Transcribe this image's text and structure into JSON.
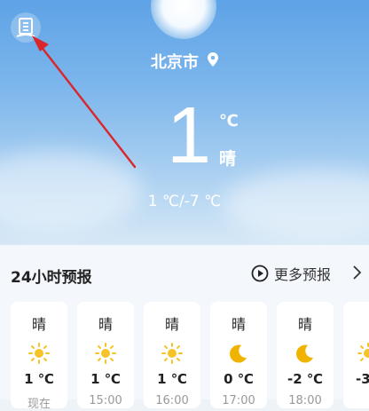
{
  "header": {
    "city": "北京市"
  },
  "current": {
    "temp": "1",
    "unit": "℃",
    "condition": "晴",
    "range": "1 ℃/-7 ℃"
  },
  "forecast": {
    "title": "24小时预报",
    "more_label": "更多预报",
    "cards": [
      {
        "condition": "晴",
        "icon": "sun-icon",
        "temp": "1 ℃",
        "time": "现在"
      },
      {
        "condition": "晴",
        "icon": "sun-icon",
        "temp": "1 ℃",
        "time": "15:00"
      },
      {
        "condition": "晴",
        "icon": "sun-icon",
        "temp": "1 ℃",
        "time": "16:00"
      },
      {
        "condition": "晴",
        "icon": "moon-icon",
        "temp": "0 ℃",
        "time": "17:00"
      },
      {
        "condition": "晴",
        "icon": "moon-icon",
        "temp": "-2 ℃",
        "time": "18:00"
      },
      {
        "condition": "",
        "icon": "sun-icon",
        "temp": "-3",
        "time": ""
      }
    ]
  },
  "colors": {
    "sky_top": "#5ea3e6",
    "sky_bottom": "#d6e8f6",
    "arrow": "#d9262b",
    "sun": "#f6c428",
    "moon": "#f0b400"
  }
}
